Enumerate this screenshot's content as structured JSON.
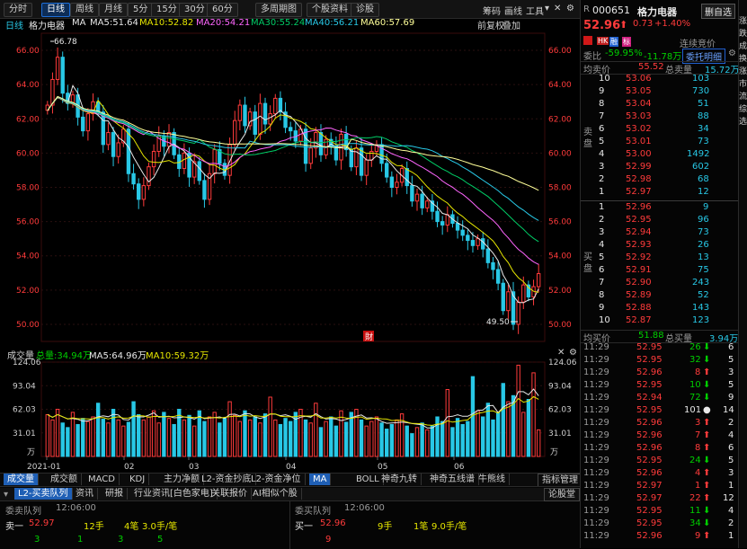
{
  "toolbar": {
    "buttons": [
      "分时",
      "日线",
      "周线",
      "月线",
      "5分",
      "15分",
      "30分",
      "60分",
      "多周期图",
      "个股资料",
      "诊股"
    ],
    "active": "日线",
    "right_links": [
      "筹码",
      "画线",
      "工具"
    ]
  },
  "infoline": {
    "period": "日线",
    "name": "格力电器",
    "ma_label": "MA",
    "ma5": "MA5:51.64",
    "ma10": "MA10:52.82",
    "ma20": "MA20:54.21",
    "ma30": "MA30:55.24",
    "ma40": "MA40:56.21",
    "ma60": "MA60:57.69",
    "adjust": "前复权",
    "overlay": "叠加"
  },
  "chart_data": {
    "type": "candlestick",
    "ylim": [
      49,
      67
    ],
    "yticks_left": [
      "66.00",
      "64.00",
      "62.00",
      "60.00",
      "58.00",
      "56.00",
      "54.00",
      "52.00",
      "50.00"
    ],
    "yticks_right": [
      "66.00",
      "64.00",
      "62.00",
      "60.00",
      "58.00",
      "56.00",
      "54.00",
      "52.00",
      "50.00"
    ],
    "x_labels": [
      "2021-01",
      "02",
      "03",
      "04",
      "05",
      "06"
    ],
    "high_label": "66.78",
    "low_label": "49.50",
    "event_marker": "財",
    "closes": [
      62.8,
      64.3,
      65.6,
      63.5,
      62.9,
      63.4,
      62.1,
      61.3,
      62.3,
      63.0,
      62.4,
      60.5,
      61.2,
      59.8,
      60.6,
      61.4,
      58.8,
      58.2,
      57.3,
      58.1,
      59.2,
      60.1,
      61.0,
      60.4,
      61.2,
      59.9,
      59.1,
      60.0,
      58.6,
      59.5,
      58.4,
      57.3,
      58.8,
      60.2,
      59.4,
      58.7,
      60.5,
      61.9,
      62.8,
      61.6,
      62.4,
      61.1,
      62.9,
      61.7,
      62.3,
      63.2,
      62.4,
      61.5,
      61.3,
      60.7,
      61.4,
      59.4,
      60.3,
      61.2,
      59.9,
      60.8,
      60.4,
      59.6,
      61.1,
      60.2,
      59.2,
      60.3,
      58.7,
      59.6,
      60.1,
      60.5,
      59.4,
      58.6,
      58.0,
      58.3,
      59.1,
      58.1,
      57.2,
      57.6,
      56.8,
      57.2,
      56.6,
      56.0,
      55.8,
      56.4,
      55.9,
      55.5,
      55.2,
      54.9,
      54.6,
      55.0,
      54.4,
      53.6,
      53.2,
      52.4,
      50.8,
      51.9,
      50.0,
      51.3,
      52.3,
      51.6,
      52.2,
      52.96
    ],
    "ma_series": [
      "MA5",
      "MA10",
      "MA20",
      "MA30",
      "MA40",
      "MA60"
    ],
    "ma_colors": [
      "#e8e8e8",
      "#e6e600",
      "#ff66ff",
      "#00cc66",
      "#28c8e6",
      "#ffff99"
    ],
    "ma_last": [
      51.64,
      52.82,
      54.21,
      55.24,
      56.21,
      57.69
    ]
  },
  "volume": {
    "title": "成交量",
    "total": "总量:34.94万",
    "ma5": "MA5:64.96万",
    "ma10": "MA10:59.32万",
    "yticks": [
      "124.06",
      "93.04",
      "62.03",
      "31.01"
    ],
    "unit": "万",
    "values": [
      55,
      48,
      62,
      44,
      38,
      58,
      42,
      50,
      46,
      52,
      70,
      49,
      44,
      62,
      48,
      40,
      45,
      72,
      55,
      48,
      52,
      60,
      44,
      58,
      50,
      42,
      62,
      48,
      54,
      40,
      60,
      46,
      52,
      58,
      44,
      50,
      72,
      54,
      46,
      60,
      48,
      52,
      44,
      56,
      78,
      48,
      42,
      50,
      46,
      58,
      62,
      48,
      44,
      70,
      38,
      46,
      52,
      40,
      60,
      45,
      58,
      62,
      48,
      40,
      46,
      52,
      44,
      36,
      42,
      48,
      56,
      40,
      30,
      38,
      44,
      35,
      40,
      52,
      46,
      88,
      38,
      50,
      42,
      46,
      105,
      60,
      52,
      70,
      48,
      58,
      96,
      72,
      80,
      120,
      58,
      75,
      110,
      34.94
    ]
  },
  "indicator_tabs": [
    "成交量",
    "成交额",
    "MACD",
    "KDJ",
    "主力净额",
    "L2-资金抄底",
    "L2-资金净位"
  ],
  "overlay_tabs": [
    "MA",
    "BOLL",
    "神奇九转",
    "神奇五线谱",
    "牛熊线"
  ],
  "indicator_manage": "指标管理",
  "bottom": {
    "tabs": [
      "L2-买卖队列",
      "资讯",
      "研报",
      "行业资讯[白色家电]",
      "关联报价",
      "AI相似个股"
    ],
    "right_tab": "论股堂",
    "sell_queue_title": "委卖队列",
    "sell_time": "12:06:00",
    "sell_label": "卖一",
    "sell_price": "52.97",
    "sell_hands": "12手",
    "sell_orders": "4笔",
    "sell_avg": "3.0手/笔",
    "sell_items": [
      "3",
      "1",
      "3",
      "5"
    ],
    "buy_queue_title": "委买队列",
    "buy_time": "12:06:00",
    "buy_label": "买一",
    "buy_price": "52.96",
    "buy_hands": "9手",
    "buy_orders": "1笔",
    "buy_avg": "9.0手/笔",
    "buy_items": [
      "9"
    ]
  },
  "quote": {
    "code": "000651",
    "name": "格力电器",
    "button": "删自选",
    "price": "52.96",
    "change": "0.73",
    "pct": "+1.40%",
    "tags": [
      "HK",
      "融",
      "标"
    ],
    "bidding": "连续竞价",
    "webi_label": "委比",
    "webi_pct": "-59.95%",
    "webi_val": "-11.78万",
    "entrust_btn": "委托明细",
    "ask_avg_label": "均卖价",
    "ask_avg": "55.52",
    "ask_total_label": "总卖量",
    "ask_total": "15.72万",
    "sell_side": "卖盘",
    "buy_side": "买盘",
    "asks": [
      {
        "lvl": "10",
        "price": "53.06",
        "vol": "103"
      },
      {
        "lvl": "9",
        "price": "53.05",
        "vol": "730"
      },
      {
        "lvl": "8",
        "price": "53.04",
        "vol": "51"
      },
      {
        "lvl": "7",
        "price": "53.03",
        "vol": "88"
      },
      {
        "lvl": "6",
        "price": "53.02",
        "vol": "34"
      },
      {
        "lvl": "5",
        "price": "53.01",
        "vol": "73"
      },
      {
        "lvl": "4",
        "price": "53.00",
        "vol": "1492"
      },
      {
        "lvl": "3",
        "price": "52.99",
        "vol": "602"
      },
      {
        "lvl": "2",
        "price": "52.98",
        "vol": "68"
      },
      {
        "lvl": "1",
        "price": "52.97",
        "vol": "12"
      }
    ],
    "bids": [
      {
        "lvl": "1",
        "price": "52.96",
        "vol": "9"
      },
      {
        "lvl": "2",
        "price": "52.95",
        "vol": "96"
      },
      {
        "lvl": "3",
        "price": "52.94",
        "vol": "73"
      },
      {
        "lvl": "4",
        "price": "52.93",
        "vol": "26"
      },
      {
        "lvl": "5",
        "price": "52.92",
        "vol": "13"
      },
      {
        "lvl": "6",
        "price": "52.91",
        "vol": "75"
      },
      {
        "lvl": "7",
        "price": "52.90",
        "vol": "243"
      },
      {
        "lvl": "8",
        "price": "52.89",
        "vol": "52"
      },
      {
        "lvl": "9",
        "price": "52.88",
        "vol": "143"
      },
      {
        "lvl": "10",
        "price": "52.87",
        "vol": "123"
      }
    ],
    "bid_avg_label": "均买价",
    "bid_avg": "51.88",
    "bid_total_label": "总买量",
    "bid_total": "3.94万",
    "ticks": [
      {
        "t": "11:29",
        "p": "52.95",
        "v": "26",
        "d": "down",
        "n": "6"
      },
      {
        "t": "11:29",
        "p": "52.95",
        "v": "32",
        "d": "down",
        "n": "5"
      },
      {
        "t": "11:29",
        "p": "52.96",
        "v": "8",
        "d": "up",
        "n": "3"
      },
      {
        "t": "11:29",
        "p": "52.95",
        "v": "10",
        "d": "down",
        "n": "5"
      },
      {
        "t": "11:29",
        "p": "52.94",
        "v": "72",
        "d": "down",
        "n": "9"
      },
      {
        "t": "11:29",
        "p": "52.95",
        "v": "101",
        "d": "flat",
        "n": "14"
      },
      {
        "t": "11:29",
        "p": "52.96",
        "v": "3",
        "d": "up",
        "n": "2"
      },
      {
        "t": "11:29",
        "p": "52.96",
        "v": "7",
        "d": "up",
        "n": "4"
      },
      {
        "t": "11:29",
        "p": "52.96",
        "v": "8",
        "d": "up",
        "n": "6"
      },
      {
        "t": "11:29",
        "p": "52.95",
        "v": "24",
        "d": "down",
        "n": "5"
      },
      {
        "t": "11:29",
        "p": "52.96",
        "v": "4",
        "d": "up",
        "n": "3"
      },
      {
        "t": "11:29",
        "p": "52.97",
        "v": "1",
        "d": "up",
        "n": "1"
      },
      {
        "t": "11:29",
        "p": "52.97",
        "v": "22",
        "d": "up",
        "n": "12"
      },
      {
        "t": "11:29",
        "p": "52.95",
        "v": "11",
        "d": "down",
        "n": "4"
      },
      {
        "t": "11:29",
        "p": "52.95",
        "v": "34",
        "d": "down",
        "n": "2"
      },
      {
        "t": "11:29",
        "p": "52.96",
        "v": "9",
        "d": "up",
        "n": "1"
      }
    ]
  },
  "side_strip": [
    "涨",
    "跌",
    "成",
    "换",
    "涨",
    "市",
    "流",
    "综",
    "选"
  ]
}
